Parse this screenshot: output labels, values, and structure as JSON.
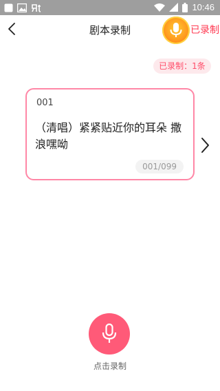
{
  "status_bar": {
    "time": "10:46",
    "icons": [
      "notification-icon",
      "image-icon",
      "app-icon",
      "wifi-icon",
      "signal-icon",
      "battery-icon"
    ]
  },
  "header": {
    "title": "剧本录制",
    "recorded_link": "已录制",
    "back_icon": "chevron-left-icon",
    "floating_icon": "microphone-icon"
  },
  "recorded_chip": "已录制：1条",
  "script_card": {
    "number": "001",
    "text": "（清唱）紧紧贴近你的耳朵 撒浪嘿呦",
    "page": "001/099"
  },
  "next_icon": "chevron-right-icon",
  "record_button": {
    "label": "点击录制",
    "icon": "microphone-icon"
  },
  "colors": {
    "accent": "#ff5a78",
    "card_border": "#ff86a6",
    "chip_bg": "#fde9ec",
    "status_bar": "#9e9e9e",
    "floating_mic": "#ff9a1f"
  }
}
